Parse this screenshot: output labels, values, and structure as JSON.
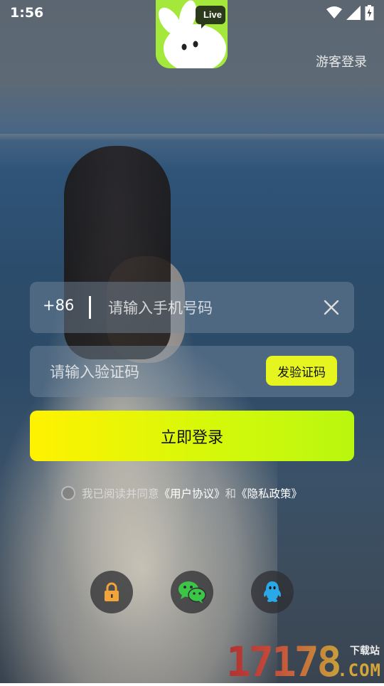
{
  "status_bar": {
    "time": "1:56",
    "icons": [
      "wifi-icon",
      "signal-icon",
      "battery-icon"
    ]
  },
  "app": {
    "logo_badge": "Live",
    "logo_color": "#a5e83c"
  },
  "header": {
    "guest_login": "游客登录"
  },
  "phone_field": {
    "country_code": "+86",
    "placeholder": "请输入手机号码",
    "value": ""
  },
  "code_field": {
    "placeholder": "请输入验证码",
    "value": "",
    "send_button": "发验证码"
  },
  "login_button": "立即登录",
  "agreement": {
    "checked": false,
    "prefix": "我已阅读并同意",
    "user_agreement": "《用户协议》",
    "conjunction": "和",
    "privacy_policy": "《隐私政策》"
  },
  "social_login": [
    "lock-icon",
    "wechat-icon",
    "qq-icon"
  ],
  "watermark": {
    "digits": "17178",
    "sub": "下载站",
    "domain": ".COM"
  },
  "colors": {
    "accent_yellow": "#e6f51f",
    "login_gradient_start": "#fff200",
    "login_gradient_end": "#b9f70f"
  }
}
